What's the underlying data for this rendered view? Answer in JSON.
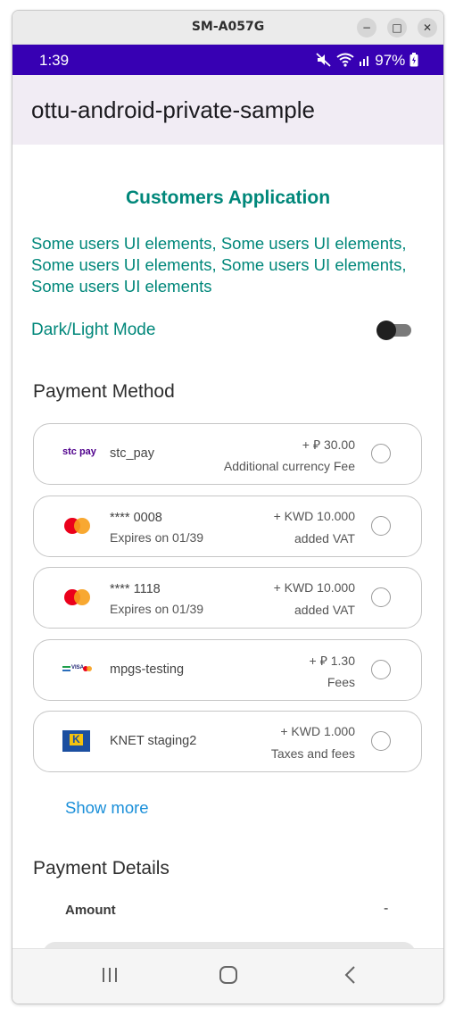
{
  "window": {
    "title": "SM-A057G",
    "minimize_glyph": "−",
    "maximize_glyph": "□",
    "close_glyph": "✕"
  },
  "status_bar": {
    "time": "1:39",
    "icons": [
      "mute-icon",
      "wifi-icon",
      "signal-icon",
      "battery-icon"
    ],
    "battery": "97%"
  },
  "app_bar": {
    "title": "ottu-android-private-sample"
  },
  "main": {
    "heading": "Customers Application",
    "paragraph": "Some users UI elements, Some users UI elements, Some users UI elements, Some users UI elements, Some users UI elements",
    "mode_label": "Dark/Light Mode",
    "mode_toggle_on": false
  },
  "payment_method": {
    "title": "Payment Method",
    "items": [
      {
        "logo": "stc-pay-logo",
        "logo_text": "stc pay",
        "name": "stc_pay",
        "sub": "",
        "fee": "+ ⃁ 30.00",
        "note": "Additional currency Fee",
        "selected": false
      },
      {
        "logo": "mastercard-logo",
        "name": "**** 0008",
        "sub": "Expires on 01/39",
        "fee": "+ KWD 10.000",
        "note": "added VAT",
        "selected": false
      },
      {
        "logo": "mastercard-logo",
        "name": "**** 1118",
        "sub": "Expires on 01/39",
        "fee": "+ KWD 10.000",
        "note": "added VAT",
        "selected": false
      },
      {
        "logo": "mpgs-logo",
        "logo_text": "VISA",
        "name": "mpgs-testing",
        "sub": "",
        "fee": "+ ⃁ 1.30",
        "note": "Fees",
        "selected": false
      },
      {
        "logo": "knet-logo",
        "logo_text": "K",
        "name": "KNET staging2",
        "sub": "",
        "fee": "+ KWD 1.000",
        "note": "Taxes and fees",
        "selected": false
      }
    ],
    "show_more": "Show more"
  },
  "payment_details": {
    "title": "Payment Details",
    "amount_label": "Amount",
    "amount_value": "-"
  },
  "nav_bar": {
    "recents_icon": "recents-icon",
    "home_icon": "home-icon",
    "back_icon": "back-icon"
  },
  "colors": {
    "status_bar": "#3700b3",
    "app_bar": "#f1ecf4",
    "accent_teal": "#00877a",
    "link_blue": "#1a8fd9"
  }
}
